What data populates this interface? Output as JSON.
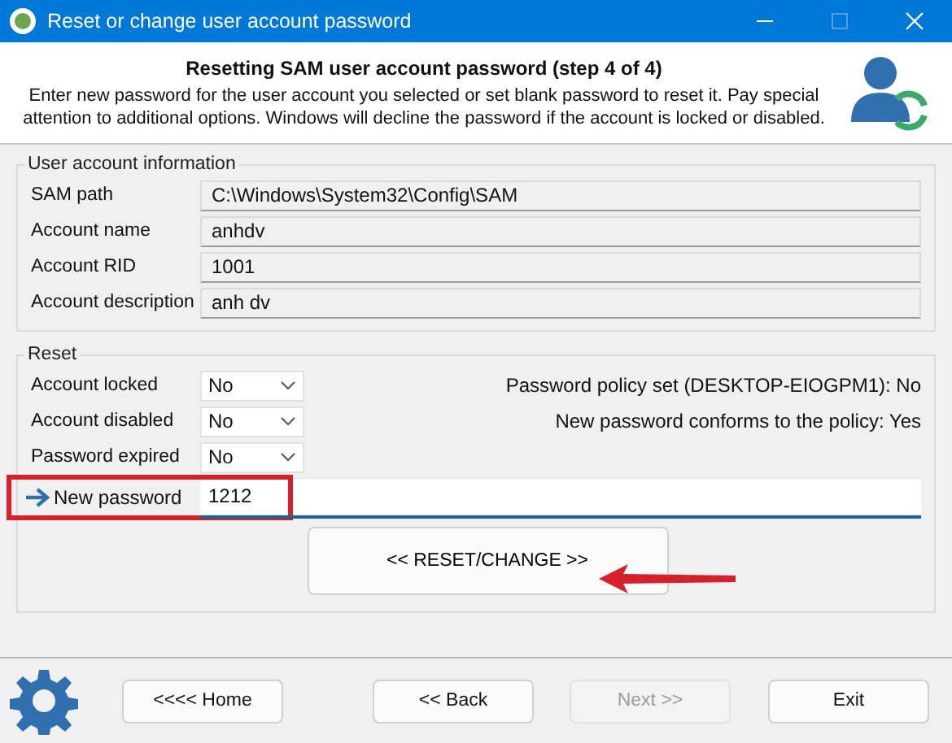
{
  "window": {
    "title": "Reset or change user account password"
  },
  "header": {
    "heading": "Resetting SAM user account password (step 4 of 4)",
    "description": "Enter new password for the user account you selected or set blank password to reset it. Pay special attention to additional options. Windows will decline the password if the account is locked or disabled."
  },
  "account_info": {
    "title": "User account information",
    "fields": [
      {
        "label": "SAM path",
        "value": "C:\\Windows\\System32\\Config\\SAM"
      },
      {
        "label": "Account name",
        "value": "anhdv"
      },
      {
        "label": "Account RID",
        "value": "1001"
      },
      {
        "label": "Account description",
        "value": "anh dv"
      }
    ]
  },
  "reset": {
    "title": "Reset",
    "options": [
      {
        "label": "Account locked",
        "value": "No",
        "note": "Password policy set (DESKTOP-EIOGPM1): No"
      },
      {
        "label": "Account disabled",
        "value": "No",
        "note": "New password conforms to the policy: Yes"
      },
      {
        "label": "Password expired",
        "value": "No"
      }
    ],
    "new_password": {
      "label": "New password",
      "value": "1212"
    },
    "action_button": "<<  RESET/CHANGE  >>"
  },
  "buttons": [
    {
      "label": "<<<<  Home",
      "disabled": false
    },
    {
      "label": "<< Back",
      "disabled": false
    },
    {
      "label": "Next >>",
      "disabled": true
    },
    {
      "label": "Exit",
      "disabled": false
    }
  ]
}
